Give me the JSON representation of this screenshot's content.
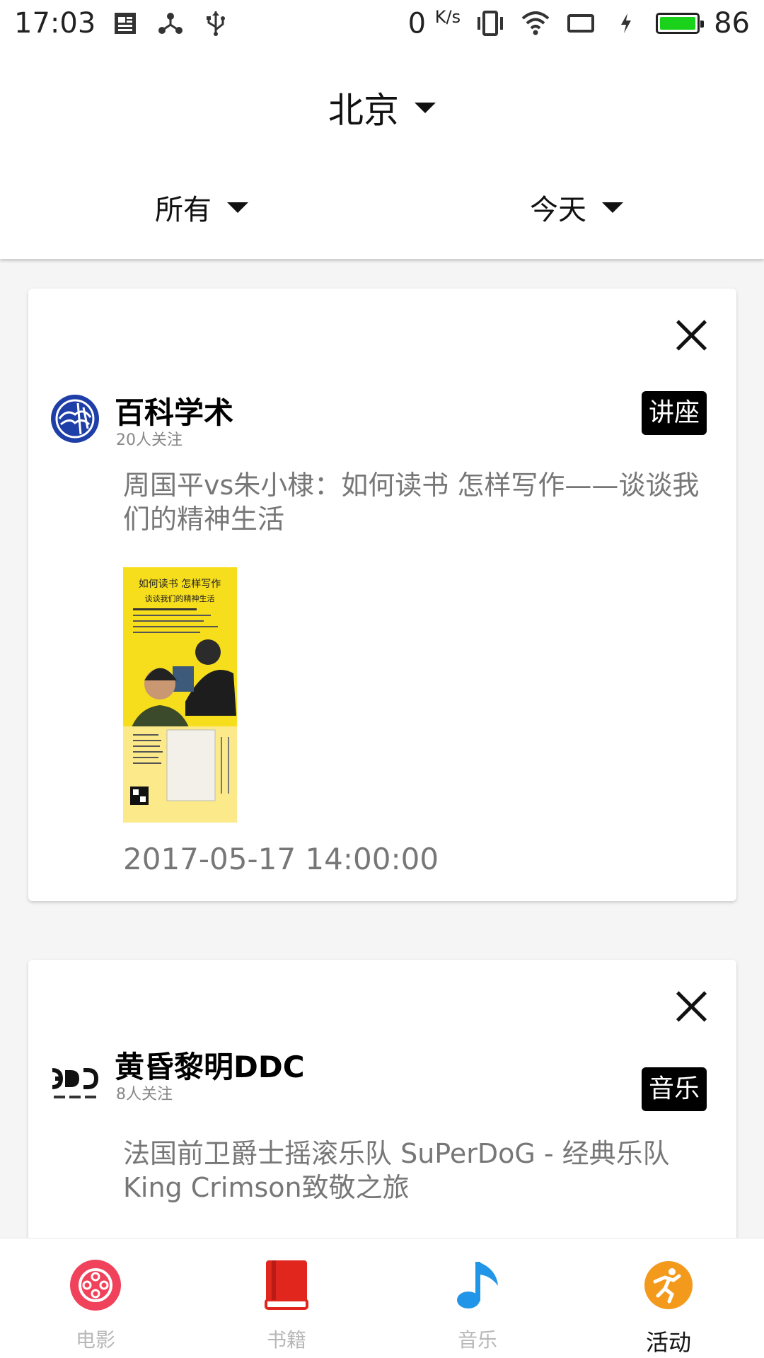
{
  "status_bar": {
    "time": "17:03",
    "net_speed": "0",
    "net_speed_unit": "K/s",
    "battery": "86",
    "icons": [
      "notification-icon",
      "share-icon",
      "usb-icon",
      "vibrate-icon",
      "wifi-icon",
      "screen-icon",
      "charging-icon",
      "battery-icon"
    ]
  },
  "header": {
    "city": "北京",
    "filter_category": "所有",
    "filter_date": "今天"
  },
  "events": [
    {
      "org_name": "百科学术",
      "followers": "20人关注",
      "tag": "讲座",
      "title": "周国平vs朱小棣：如何读书  怎样写作——谈谈我们的精神生活",
      "poster_line1": "如何读书  怎样写作",
      "poster_line2": "谈谈我们的精神生活",
      "datetime": "2017-05-17  14:00:00"
    },
    {
      "org_name": "黄昏黎明DDC",
      "followers": "8人关注",
      "tag": "音乐",
      "title": "法国前卫爵士摇滚乐队  SuPerDoG  -  经典乐队King  Crimson致敬之旅"
    }
  ],
  "bottom_nav": {
    "items": [
      {
        "label": "电影",
        "icon": "movie-reel-icon",
        "color": "#f0425a"
      },
      {
        "label": "书籍",
        "icon": "book-icon",
        "color": "#e0261d"
      },
      {
        "label": "音乐",
        "icon": "music-note-icon",
        "color": "#2196e8"
      },
      {
        "label": "活动",
        "icon": "activity-runner-icon",
        "color": "#f39a1c"
      }
    ],
    "active": "活动"
  }
}
